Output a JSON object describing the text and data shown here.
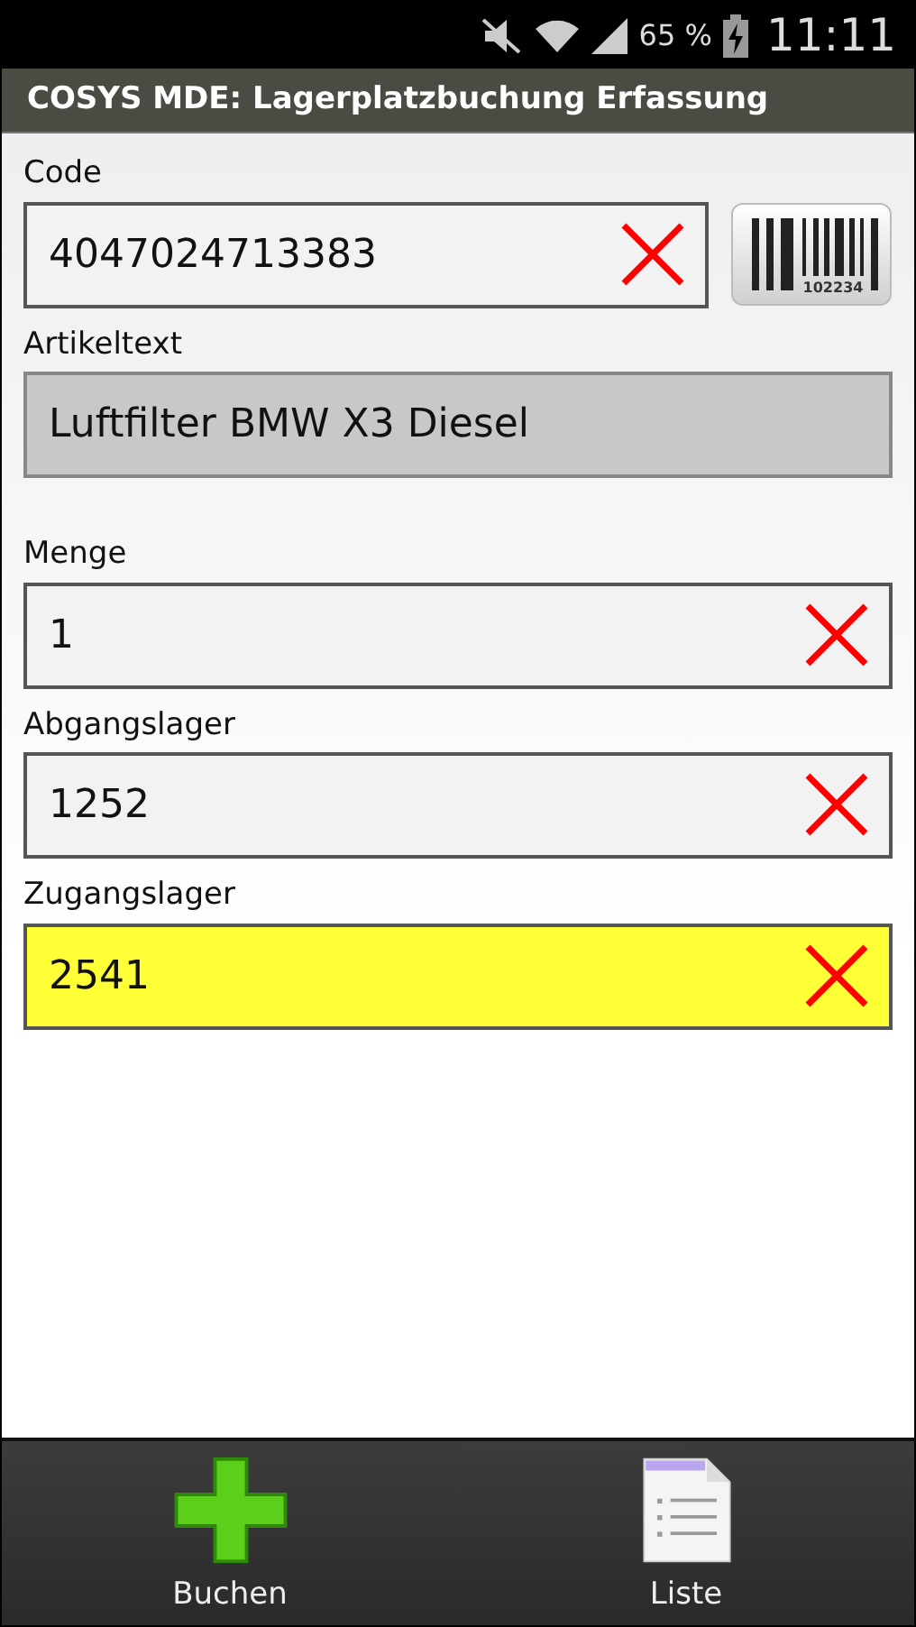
{
  "status_bar": {
    "battery": "65 %",
    "time": "11:11"
  },
  "window": {
    "title": "COSYS MDE: Lagerplatzbuchung Erfassung"
  },
  "fields": [
    {
      "label": "Code",
      "kind": "input",
      "value": "4047024713383",
      "focused": false,
      "scan_button": {
        "barcode_number": "102234"
      }
    },
    {
      "label": "Artikeltext",
      "kind": "readonly",
      "value": "Luftfilter BMW X3 Diesel"
    },
    {
      "label": "Menge",
      "kind": "input",
      "value": "1",
      "focused": false
    },
    {
      "label": "Abgangslager",
      "kind": "input",
      "value": "1252",
      "focused": false
    },
    {
      "label": "Zugangslager",
      "kind": "input",
      "value": "2541",
      "focused": true
    }
  ],
  "bottom_bar": [
    {
      "label": "Buchen",
      "kind": "add"
    },
    {
      "label": "Liste",
      "kind": "list"
    }
  ]
}
